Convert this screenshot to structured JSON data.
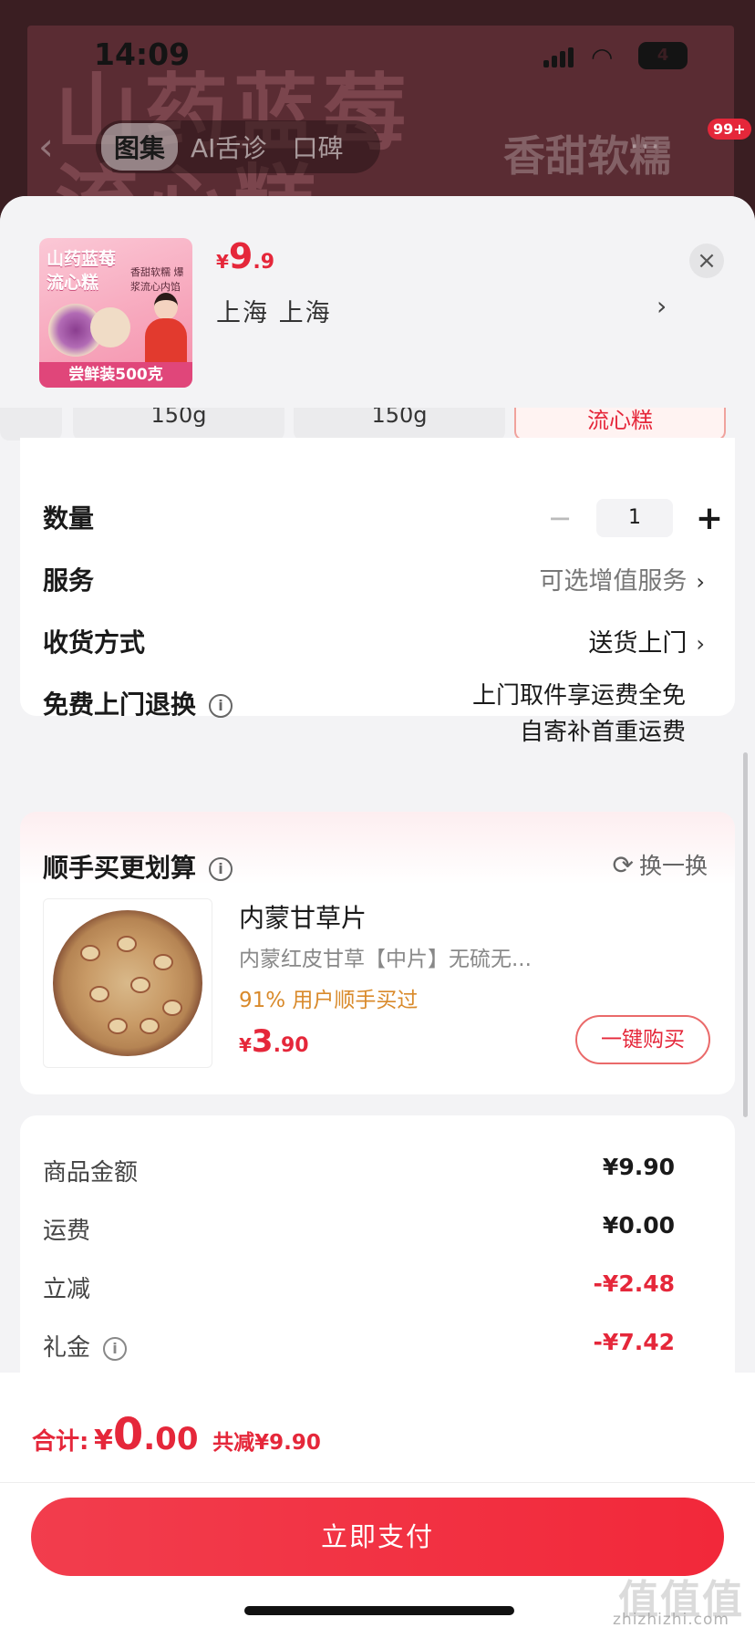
{
  "status_bar": {
    "time": "14:09",
    "battery": "4"
  },
  "background": {
    "watermark_line1": "山药蓝莓",
    "watermark_line2": "流心糕",
    "right_text": "香甜软糯",
    "tabs": [
      {
        "label": "图集",
        "active": true
      },
      {
        "label": "AI舌诊",
        "active": false
      },
      {
        "label": "口碑",
        "active": false
      }
    ],
    "badge": "99+"
  },
  "product": {
    "thumb": {
      "title": "山药蓝莓流心糕",
      "subtitle": "香甜软糯 爆浆流心内馅",
      "footer": "尝鲜装500克"
    },
    "price": {
      "currency": "¥",
      "integer": "9",
      "decimal": ".9"
    },
    "location": "上海  上海",
    "close": "×"
  },
  "options": [
    {
      "label": "150g",
      "selected": false
    },
    {
      "label": "150g",
      "selected": false
    },
    {
      "label": "流心糕",
      "selected": true
    }
  ],
  "order": {
    "quantity_label": "数量",
    "quantity_minus": "−",
    "quantity_value": "1",
    "quantity_plus": "+",
    "service_label": "服务",
    "service_value": "可选增值服务",
    "delivery_label": "收货方式",
    "delivery_value": "送货上门",
    "return_label": "免费上门退换",
    "return_line1": "上门取件享运费全免",
    "return_line2": "自寄补首重运费"
  },
  "recommend": {
    "title": "顺手买更划算",
    "refresh": "换一换",
    "item_name": "内蒙甘草片",
    "item_desc": "内蒙红皮甘草【中片】无硫无...",
    "item_bought": "91% 用户顺手买过",
    "price": {
      "currency": "¥",
      "integer": "3",
      "decimal": ".90"
    },
    "buy_button": "一键购买"
  },
  "summary": [
    {
      "label": "商品金额",
      "value": "¥9.90",
      "red": false,
      "info": false
    },
    {
      "label": "运费",
      "value": "¥0.00",
      "red": false,
      "info": false
    },
    {
      "label": "立减",
      "value": "-¥2.48",
      "red": true,
      "info": false
    },
    {
      "label": "礼金",
      "value": "-¥7.42",
      "red": true,
      "info": true
    }
  ],
  "footer": {
    "total_label": "合计:",
    "currency": "¥",
    "integer": "0",
    "decimal": ".00",
    "saved": "共减¥9.90",
    "pay_button": "立即支付"
  },
  "watermark": {
    "big": "值值值",
    "small": "zhizhizhi.com"
  },
  "colors": {
    "accent": "#e5273a",
    "orange": "#d98a2b"
  },
  "icons": [
    "back-icon",
    "close-icon",
    "chevron-right-icon",
    "info-icon",
    "refresh-icon",
    "signal-icon",
    "wifi-icon",
    "battery-icon"
  ]
}
